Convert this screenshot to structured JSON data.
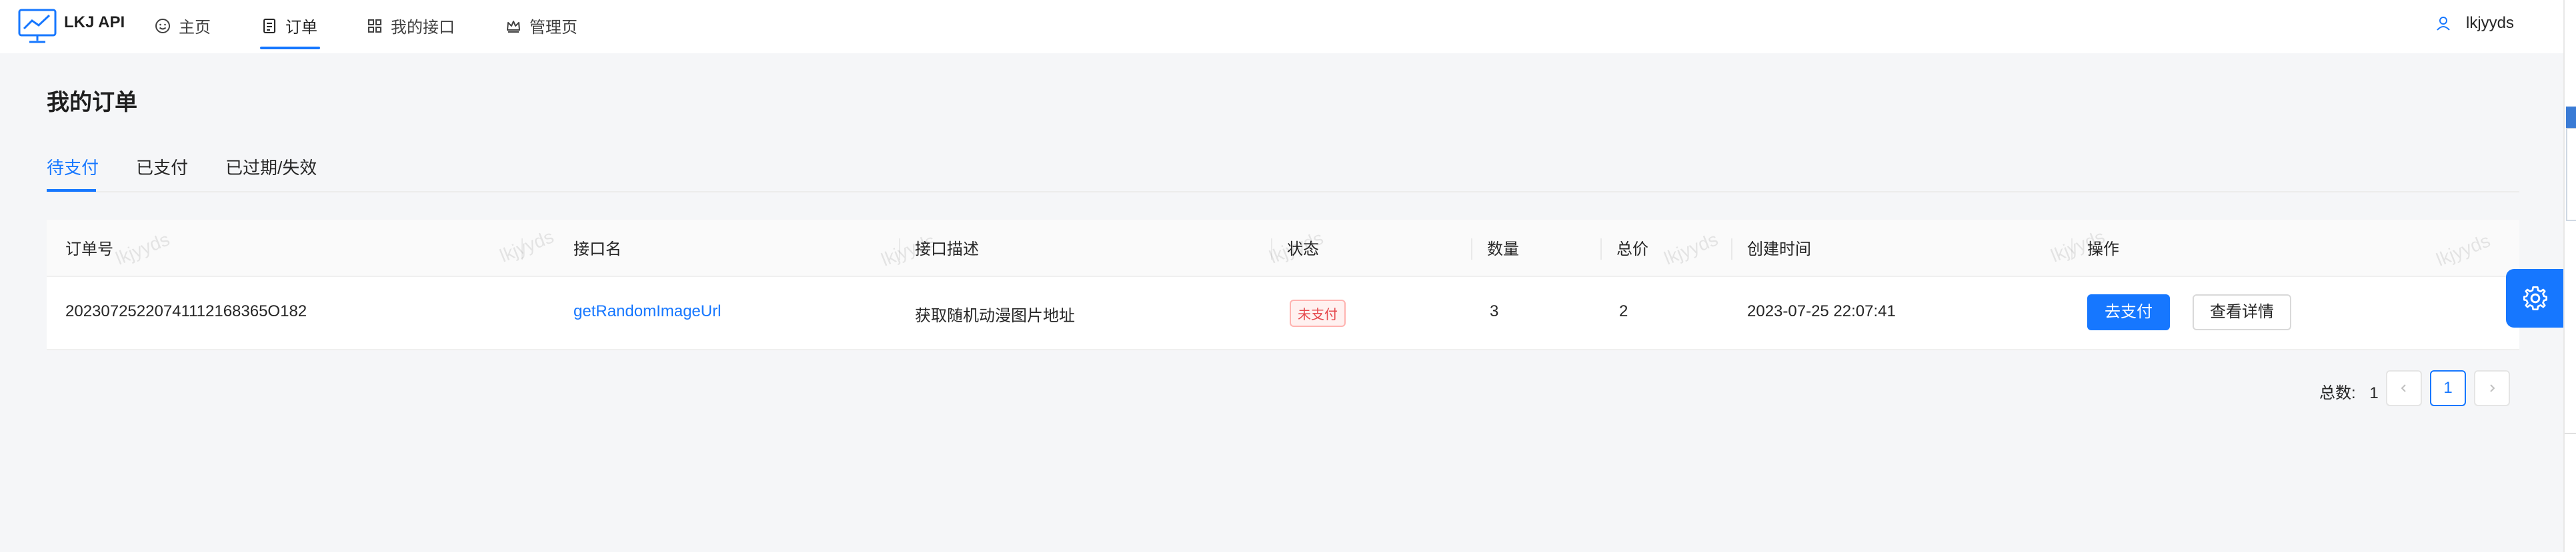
{
  "header": {
    "app_title": "LKJ API",
    "nav": [
      {
        "label": "主页",
        "icon": "smile-icon"
      },
      {
        "label": "订单",
        "icon": "order-icon",
        "active": true
      },
      {
        "label": "我的接口",
        "icon": "grid-icon"
      },
      {
        "label": "管理页",
        "icon": "crown-icon"
      }
    ],
    "user": {
      "name": "lkjyyds",
      "icon": "user-icon"
    }
  },
  "page": {
    "title": "我的订单",
    "tabs": [
      {
        "label": "待支付",
        "active": true
      },
      {
        "label": "已支付"
      },
      {
        "label": "已过期/失效"
      }
    ]
  },
  "table": {
    "columns": [
      "订单号",
      "接口名",
      "接口描述",
      "状态",
      "数量",
      "总价",
      "创建时间",
      "操作"
    ],
    "rows": [
      {
        "order_no": "20230725220741112168365O182",
        "api_name": "getRandomImageUrl",
        "description": "获取随机动漫图片地址",
        "status": "未支付",
        "quantity": "3",
        "total": "2",
        "created_at": "2023-07-25 22:07:41",
        "actions": {
          "pay": "去支付",
          "detail": "查看详情"
        }
      }
    ]
  },
  "watermark": "lkjyyds",
  "pagination": {
    "total_label": "总数:",
    "total": "1",
    "current_page": "1"
  },
  "colors": {
    "accent": "#1677ff",
    "status_unpaid": "#e5484d"
  },
  "settings_icon": "gear-icon"
}
